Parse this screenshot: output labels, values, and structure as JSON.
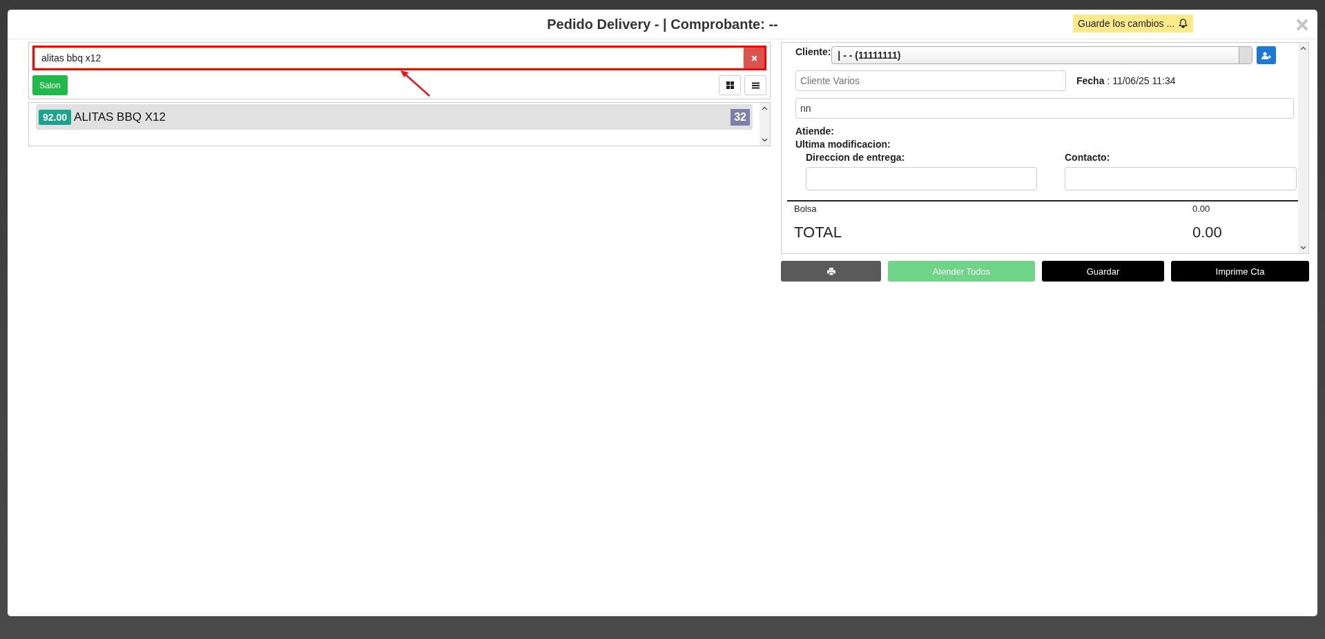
{
  "modal": {
    "title": "Pedido Delivery - | Comprobante: --",
    "unsaved_notice": "Guarde los cambios ..."
  },
  "search": {
    "value": "alitas bbq x12"
  },
  "filter_buttons": [
    {
      "label": "Salon"
    }
  ],
  "view_toggle": [
    {
      "kind": "grid",
      "selected": false
    },
    {
      "kind": "list",
      "selected": false
    }
  ],
  "products": [
    {
      "price": "92.00",
      "name": "ALITAS BBQ X12",
      "count": "32"
    }
  ],
  "order": {
    "client_label": "Cliente:",
    "client_value": "| - - (11111111)",
    "client_name_placeholder": "Cliente Varios",
    "date_label": "Fecha",
    "date_value": ": 11/06/25 11:34",
    "note_value": "nn",
    "attends_label": "Atiende:",
    "modified_label": "Ultima modificacion:",
    "address_label": "Direccion de entrega:",
    "contact_label": "Contacto:"
  },
  "totals": [
    {
      "kind": "line",
      "label": "Bolsa",
      "value": "0.00"
    },
    {
      "kind": "grand",
      "label": "TOTAL",
      "value": "0.00"
    }
  ],
  "actions": [
    {
      "kind": "print",
      "disabled": false
    },
    {
      "kind": "success",
      "label": "Atender Todos",
      "disabled": true
    },
    {
      "kind": "dark",
      "label": "Guardar",
      "disabled": false
    },
    {
      "kind": "dark",
      "label": "Imprime Cta",
      "disabled": false
    }
  ]
}
